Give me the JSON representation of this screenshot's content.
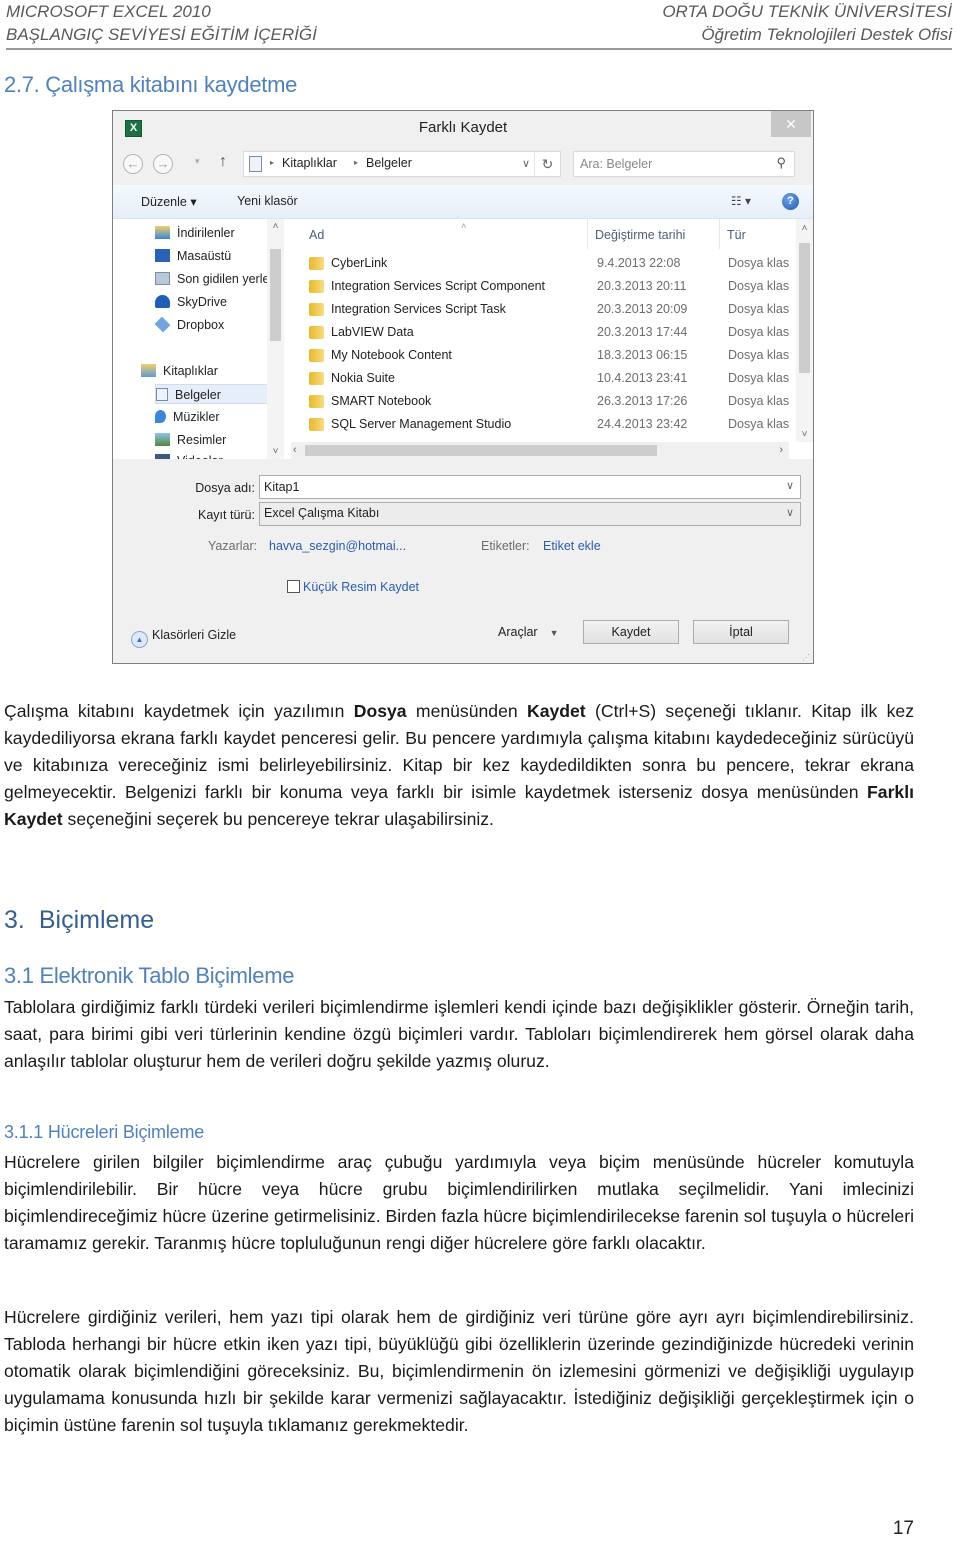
{
  "header": {
    "left_line1": "MICROSOFT EXCEL 2010",
    "left_line2": "BAŞLANGIÇ SEVİYESİ EĞİTİM İÇERİĞİ",
    "right_line1": "ORTA DOĞU TEKNİK ÜNİVERSİTESİ",
    "right_line2": "Öğretim Teknolojileri Destek Ofisi"
  },
  "section_heading": "2.7. Çalışma kitabını kaydetme",
  "dialog": {
    "title": "Farklı Kaydet",
    "app_icon": "excel-icon",
    "close_label": "✕",
    "nav": {
      "back": "←",
      "forward": "→",
      "history": "▾",
      "up": "↑",
      "breadcrumb": [
        "Kitaplıklar",
        "Belgeler"
      ],
      "breadcrumb_sep": "▸",
      "dropdown": "∨",
      "refresh": "↻",
      "search_placeholder": "Ara: Belgeler",
      "search_icon": "⚲"
    },
    "toolbar": {
      "organize": "Düzenle ▾",
      "new_folder": "Yeni klasör",
      "view": "☷ ▾",
      "help": "?"
    },
    "tree": {
      "items": [
        {
          "label": "İndirilenler",
          "icon": "downloads-icon"
        },
        {
          "label": "Masaüstü",
          "icon": "desktop-icon"
        },
        {
          "label": "Son gidilen yerler",
          "icon": "recent-places-icon"
        },
        {
          "label": "SkyDrive",
          "icon": "skydrive-icon"
        },
        {
          "label": "Dropbox",
          "icon": "dropbox-icon"
        },
        {
          "label": "Kitaplıklar",
          "icon": "libraries-icon"
        },
        {
          "label": "Belgeler",
          "icon": "documents-icon",
          "selected": true
        },
        {
          "label": "Müzikler",
          "icon": "music-icon"
        },
        {
          "label": "Resimler",
          "icon": "pictures-icon"
        },
        {
          "label": "Videolar",
          "icon": "videos-icon"
        }
      ]
    },
    "columns": {
      "name": "Ad",
      "date": "Değiştirme tarihi",
      "type": "Tür"
    },
    "files": [
      {
        "name": "CyberLink",
        "date": "9.4.2013 22:08",
        "type": "Dosya klasörü"
      },
      {
        "name": "Integration Services Script Component",
        "date": "20.3.2013 20:11",
        "type": "Dosya klasörü"
      },
      {
        "name": "Integration Services Script Task",
        "date": "20.3.2013 20:09",
        "type": "Dosya klasörü"
      },
      {
        "name": "LabVIEW Data",
        "date": "20.3.2013 17:44",
        "type": "Dosya klasörü"
      },
      {
        "name": "My Notebook Content",
        "date": "18.3.2013 06:15",
        "type": "Dosya klasörü"
      },
      {
        "name": "Nokia Suite",
        "date": "10.4.2013 23:41",
        "type": "Dosya klasörü"
      },
      {
        "name": "SMART Notebook",
        "date": "26.3.2013 17:26",
        "type": "Dosya klasörü"
      },
      {
        "name": "SQL Server Management Studio",
        "date": "24.4.2013 23:42",
        "type": "Dosya klasörü"
      }
    ],
    "form": {
      "filename_label": "Dosya adı:",
      "filename_value": "Kitap1",
      "type_label": "Kayıt türü:",
      "type_value": "Excel Çalışma Kitabı",
      "authors_label": "Yazarlar:",
      "authors_value": "havva_sezgin@hotmai...",
      "tags_label": "Etiketler:",
      "tags_value": "Etiket ekle",
      "thumbnail_label": "Küçük Resim Kaydet",
      "thumbnail_checked": false
    },
    "footer": {
      "hide_folders": "Klasörleri Gizle",
      "tools": "Araçlar",
      "save": "Kaydet",
      "cancel": "İptal"
    }
  },
  "paragraph_1": {
    "parts": [
      {
        "t": "Çalışma kitabını kaydetmek için yazılımın ",
        "b": false
      },
      {
        "t": "Dosya",
        "b": true
      },
      {
        "t": " menüsünden ",
        "b": false
      },
      {
        "t": "Kaydet",
        "b": true
      },
      {
        "t": " (Ctrl+S) seçeneği tıklanır. Kitap ilk kez kaydediliyorsa ekrana farklı kaydet penceresi gelir. Bu pencere yardımıyla çalışma kitabını kaydedeceğiniz sürücüyü ve kitabınıza vereceğiniz ismi belirleyebilirsiniz. Kitap bir kez kaydedildikten sonra bu pencere, tekrar ekrana gelmeyecektir. Belgenizi farklı bir konuma veya farklı bir isimle kaydetmek isterseniz dosya menüsünden ",
        "b": false
      },
      {
        "t": "Farklı Kaydet",
        "b": true
      },
      {
        "t": " seçeneğini seçerek bu pencereye tekrar ulaşabilirsiniz.",
        "b": false
      }
    ]
  },
  "heading_3": {
    "number": "3.",
    "title": "Biçimleme"
  },
  "heading_3_1": "3.1 Elektronik Tablo Biçimleme",
  "paragraph_2": "Tablolara girdiğimiz farklı türdeki verileri biçimlendirme işlemleri kendi içinde bazı değişiklikler gösterir. Örneğin tarih, saat, para birimi gibi veri türlerinin kendine özgü biçimleri vardır. Tabloları biçimlendirerek hem görsel olarak daha anlaşılır tablolar oluşturur hem de verileri doğru şekilde yazmış oluruz.",
  "heading_3_1_1": "3.1.1 Hücreleri Biçimleme",
  "paragraph_3": "Hücrelere girilen bilgiler biçimlendirme araç çubuğu yardımıyla veya biçim menüsünde hücreler komutuyla biçimlendirilebilir. Bir hücre veya hücre grubu biçimlendirilirken mutlaka seçilmelidir. Yani imlecinizi biçimlendireceğimiz hücre üzerine getirmelisiniz. Birden fazla hücre biçimlendirilecekse farenin sol tuşuyla o hücreleri taramamız gerekir. Taranmış hücre topluluğunun rengi diğer hücrelere göre farklı olacaktır.",
  "paragraph_4": "Hücrelere girdiğiniz verileri, hem yazı tipi olarak hem de girdiğiniz veri türüne göre ayrı ayrı biçimlendirebilirsiniz. Tabloda herhangi bir hücre etkin iken yazı tipi, büyüklüğü gibi özelliklerin üzerinde gezindiğinizde hücredeki verinin otomatik olarak biçimlendiğini göreceksiniz. Bu, biçimlendirmenin ön izlemesini görmenizi ve değişikliği uygulayıp uygulamama konusunda hızlı bir şekilde karar vermenizi sağlayacaktır. İstediğiniz değişikliği gerçekleştirmek için o biçimin üstüne farenin sol tuşuyla tıklamanız gerekmektedir.",
  "page_number": "17",
  "colors": {
    "heading_blue": "#4f81bd",
    "heading_dark_blue": "#365f91",
    "header_gray": "#595959",
    "link_blue": "#2a5db0"
  }
}
